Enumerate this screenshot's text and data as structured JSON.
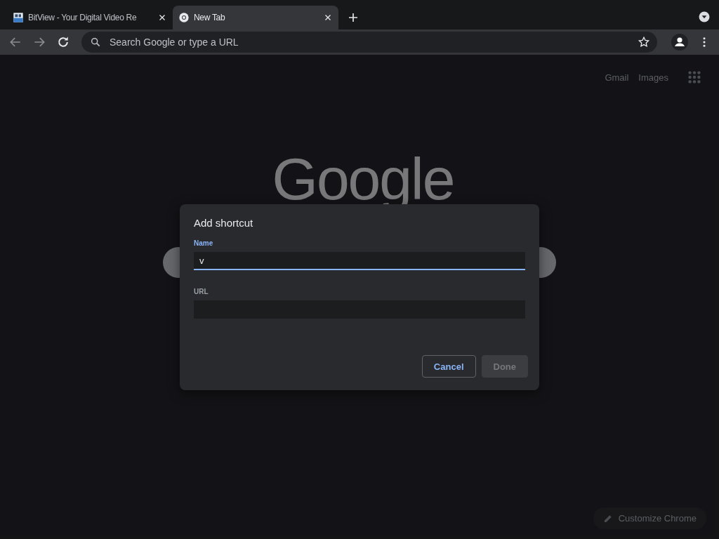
{
  "tabs": [
    {
      "title": "BitView - Your Digital Video Re",
      "selected": false
    },
    {
      "title": "New Tab",
      "selected": true
    }
  ],
  "toolbar": {
    "omnibox_placeholder": "Search Google or type a URL",
    "back_disabled": true,
    "forward_disabled": true
  },
  "header_links": [
    "Gmail",
    "Images"
  ],
  "logo": "Google",
  "dialog": {
    "title": "Add shortcut",
    "fields": [
      {
        "label": "Name",
        "value": "v",
        "focused": true
      },
      {
        "label": "URL",
        "focused": false
      }
    ],
    "buttons": [
      {
        "label": "Cancel",
        "disabled": false
      },
      {
        "label": "Done",
        "disabled": true
      }
    ]
  },
  "customize_button": "Customize Chrome"
}
